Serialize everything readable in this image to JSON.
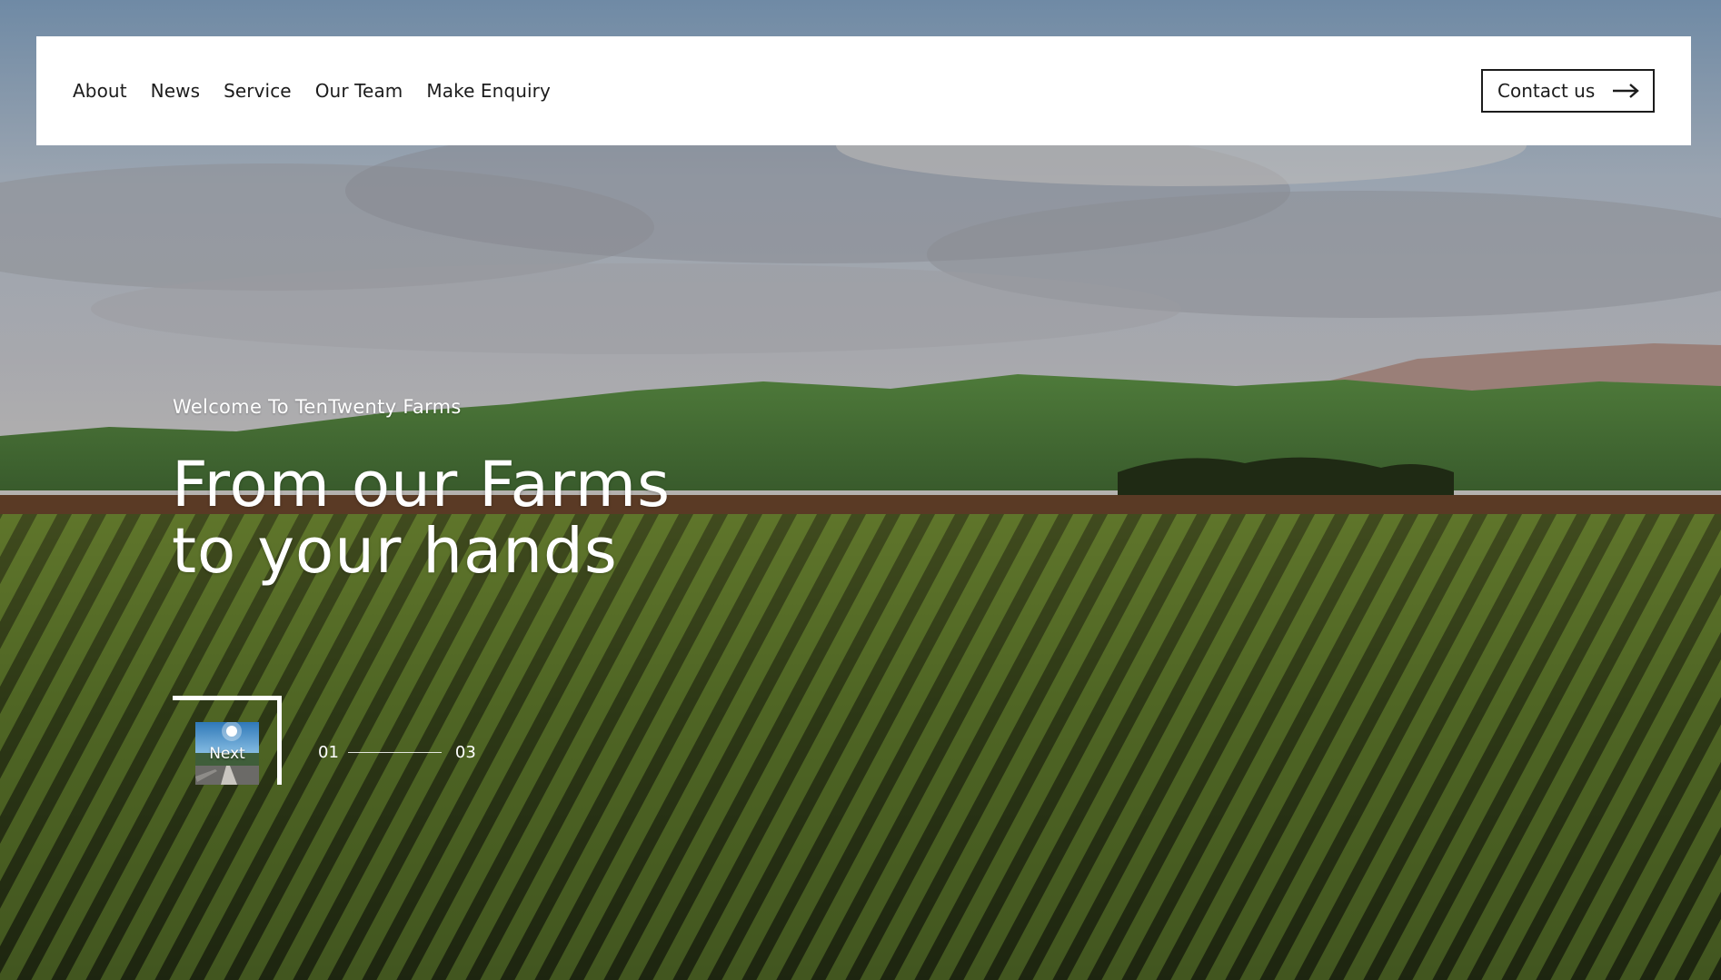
{
  "nav": {
    "links": [
      {
        "label": "About"
      },
      {
        "label": "News"
      },
      {
        "label": "Service"
      },
      {
        "label": "Our Team"
      },
      {
        "label": "Make Enquiry"
      }
    ],
    "contact_label": "Contact us",
    "contact_icon": "arrow-right-icon"
  },
  "hero": {
    "welcome": "Welcome To TenTwenty Farms",
    "headline_line1": "From our Farms",
    "headline_line2": "to your hands",
    "background": "farm-field-landscape-image"
  },
  "slider": {
    "next_label": "Next",
    "next_thumbnail": "landscape-thumbnail-image",
    "current": "01",
    "total": "03"
  },
  "colors": {
    "navbar_bg": "#ffffff",
    "text_dark": "#1c1c1c",
    "text_light": "#ffffff"
  }
}
